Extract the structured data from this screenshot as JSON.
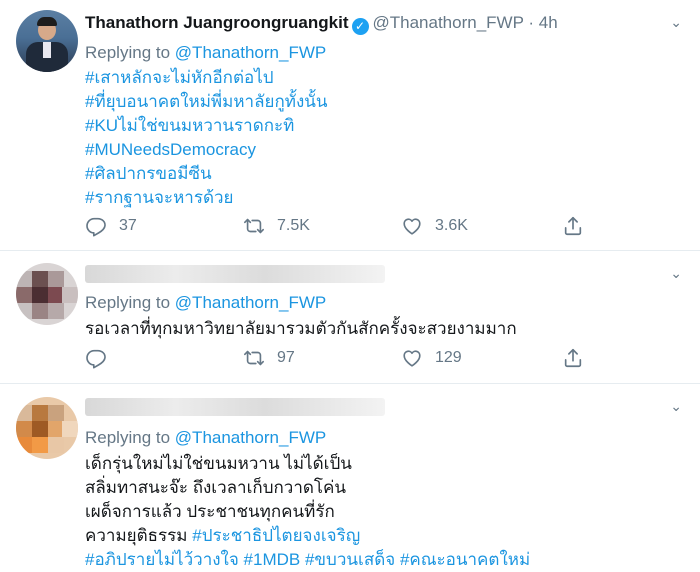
{
  "tweets": [
    {
      "author_name": "Thanathorn Juangroongruangkit",
      "handle": "@Thanathorn_FWP",
      "separator": "·",
      "time": "4h",
      "replying_prefix": "Replying to",
      "replying_to": "@Thanathorn_FWP",
      "lines": [
        "#เสาหลักจะไม่หักอีกต่อไป",
        "#ที่ยุบอนาคตใหม่พี่มหาลัยกูทั้งนั้น",
        "#KUไม่ใช่ขนมหวานราดกะทิ",
        "#MUNeedsDemocracy",
        "#ศิลปากรขอมีซีน",
        "#รากฐานจะหารด้วย"
      ],
      "counts": {
        "reply": "37",
        "retweet": "7.5K",
        "like": "3.6K"
      }
    },
    {
      "replying_prefix": "Replying to",
      "replying_to": "@Thanathorn_FWP",
      "lines": [
        "รอเวลาที่ทุกมหาวิทยาลัยมารวมตัวกันสักครั้งจะสวยงามมาก"
      ],
      "counts": {
        "reply": "",
        "retweet": "97",
        "like": "129"
      }
    },
    {
      "replying_prefix": "Replying to",
      "replying_to": "@Thanathorn_FWP",
      "lines": [
        {
          "text": "เด็กรุ่นใหม่ไม่ใช่ขนมหวาน ไม่ได้เป็น"
        },
        {
          "text": "สลิ่มทาสนะจ๊ะ ถึงเวลาเก็บกวาดโค่น"
        },
        {
          "text": "เผด็จการแล้ว ประชาชนทุกคนที่รัก"
        },
        {
          "text": "ความยุติธรรม ",
          "tag": "#ประชาธิปไตยจงเจริญ"
        },
        {
          "tags": [
            "#อภิปรายไม่ไว้วางใจ",
            "#1MDB",
            "#ขบวนเสด็จ",
            "#คณะอนาคตใหม่"
          ]
        }
      ],
      "counts": {
        "reply": "",
        "retweet": "",
        "like": ""
      }
    }
  ],
  "icons": {
    "verified": "verified-badge-icon",
    "reply": "reply-icon",
    "retweet": "retweet-icon",
    "like": "heart-icon",
    "share": "share-icon",
    "menu": "chevron-down-icon"
  },
  "colors": {
    "link": "#1b95e0",
    "muted": "#657786",
    "verified": "#1da1f2"
  }
}
